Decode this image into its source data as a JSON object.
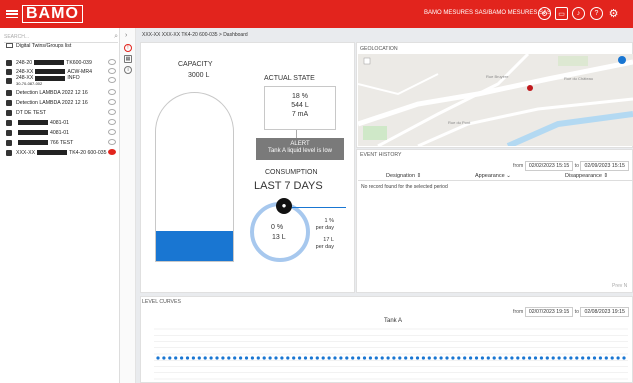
{
  "header": {
    "logo": "BAMO",
    "org": "BAMO MESURES SAS/BAMO MESURES SAS"
  },
  "sidebar": {
    "search_placeholder": "SEARCH...",
    "root": "Digital Twins/Groups list",
    "items": [
      {
        "pre": "248-20",
        "post": "TK600-039",
        "eye": "gray"
      },
      {
        "pre": "248-XX",
        "post": "ACW-MR4",
        "eye": "gray"
      },
      {
        "pre": "248-XX",
        "post": "INFO",
        "sub": "30-70-087-002",
        "eye": "gray"
      },
      {
        "pre": "Detection LAMBDA 2022 12 16",
        "post": "",
        "eye": "gray"
      },
      {
        "pre": "Detection LAMBDA 2022 12 16",
        "post": "",
        "eye": "gray"
      },
      {
        "pre": "DT DE TEST",
        "post": "",
        "eye": "gray"
      },
      {
        "pre": "",
        "post": "4081-01",
        "eye": "gray"
      },
      {
        "pre": "",
        "post": "4081-01",
        "eye": "gray"
      },
      {
        "pre": "",
        "post": "766 TEST",
        "eye": "gray"
      },
      {
        "pre": "XXX-XX",
        "post": "TK4-20 600-035",
        "eye": "red"
      }
    ]
  },
  "breadcrumb": "XXX-XX XXX-XX TK4-20 600-035 > Dashboard",
  "tank": {
    "capacity_label": "CAPACITY",
    "capacity_value": "3000 L",
    "fill_fraction": 0.18,
    "state_title": "ACTUAL STATE",
    "percent": "18 %",
    "liters": "544 L",
    "current": "7 mA",
    "alert_title": "ALERT",
    "alert_text": "Tank A liquid level is low"
  },
  "consumption": {
    "title": "CONSUMPTION",
    "period": "LAST 7 DAYS",
    "pct": "0 %",
    "liters": "13 L",
    "pct_per_day_value": "1 %",
    "pct_per_day_unit": "per day",
    "l_per_day_value": "17 L",
    "l_per_day_unit": "per day"
  },
  "geolocation": {
    "label": "GEOLOCATION",
    "roads": [
      "Rue Bruyère",
      "Rue du Pont",
      "Rue du Château"
    ]
  },
  "event_history": {
    "label": "EVENT HISTORY",
    "from_label": "from",
    "from_date": "02/02/2023 15:15",
    "to_label": "to",
    "to_date": "02/09/2023 15:15",
    "columns": [
      "Designation ⇕",
      "Appearance ⌄",
      "Disappearance ⇕"
    ],
    "empty": "No record found for the selected period",
    "pager": "Prev  N"
  },
  "level_curves": {
    "label": "LEVEL CURVES",
    "from_label": "from",
    "from_date": "02/07/2023 19:15",
    "to_label": "to",
    "to_date": "02/08/2023 19:15",
    "title": "Tank A"
  },
  "chart_data": {
    "type": "scatter",
    "title": "Tank A",
    "series": [
      {
        "values": [
          18,
          18,
          18,
          18,
          18,
          18,
          18,
          18,
          18,
          18,
          18,
          18,
          18,
          18,
          18,
          18,
          18,
          18,
          18,
          18,
          18,
          18,
          18,
          18,
          18,
          18,
          18,
          18,
          18,
          18,
          18,
          18,
          18,
          18,
          18,
          18,
          18,
          18,
          18,
          18,
          18,
          18,
          18,
          18,
          18,
          18,
          18,
          18,
          18,
          18,
          18,
          18,
          18,
          18,
          18,
          18,
          18,
          18,
          18,
          18,
          18,
          18,
          18,
          18,
          18,
          18,
          18,
          18,
          18,
          18,
          18,
          18,
          18,
          18,
          18,
          18,
          18,
          18,
          18,
          18
        ]
      }
    ],
    "ylim": [
      0,
      100
    ],
    "grid": true,
    "color": "#1976d2"
  }
}
